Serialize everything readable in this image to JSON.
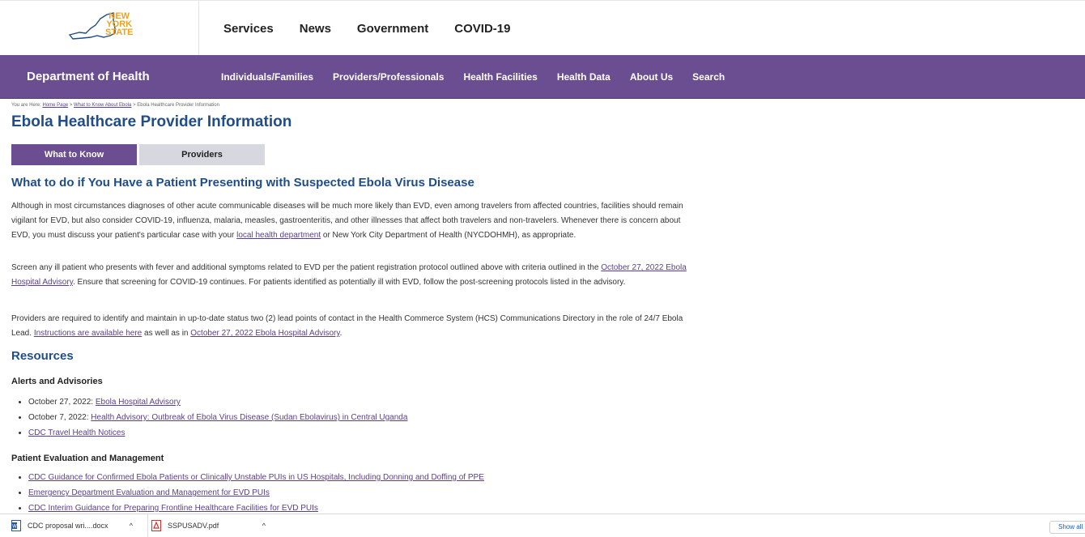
{
  "header": {
    "logo_text_1": "NEW",
    "logo_text_2": "YORK",
    "logo_text_3": "STATE",
    "nav": [
      "Services",
      "News",
      "Government",
      "COVID-19"
    ]
  },
  "subheader": {
    "department": "Department of Health",
    "nav": [
      "Individuals/Families",
      "Providers/Professionals",
      "Health Facilities",
      "Health Data",
      "About Us",
      "Search"
    ]
  },
  "breadcrumb": {
    "prefix": "You are Here:",
    "home": "Home Page",
    "sep1": " > ",
    "ebola": "What to Know About Ebola",
    "sep2": " > ",
    "current": "Ebola Healthcare Provider Information"
  },
  "page": {
    "title": "Ebola Healthcare Provider Information",
    "tabs": [
      "What to Know",
      "Providers"
    ],
    "section_title": "What to do if You Have a Patient Presenting with Suspected Ebola Virus Disease",
    "p1_a": "Although in most circumstances diagnoses of other acute communicable diseases will be much more likely than EVD, even among travelers from affected countries, facilities should remain vigilant for EVD, but also consider COVID-19, influenza, malaria, measles, gastroenteritis, and other illnesses that affect both travelers and non-travelers. Whenever there is concern about EVD, you must discuss your patient's particular case with your ",
    "p1_link": "local health department",
    "p1_b": " or New York City Department of Health (NYCDOHMH), as appropriate.",
    "p2_a": "Screen any ill patient who presents with fever and additional symptoms related to EVD per the patient registration protocol outlined above with criteria outlined in the ",
    "p2_link": "October 27, 2022 Ebola Hospital Advisory",
    "p2_b": ". Ensure that screening for COVID-19 continues. For patients identified as potentially ill with EVD, follow the post-screening protocols listed in the advisory.",
    "p3_a": "Providers are required to identify and maintain in up-to-date status two (2) lead points of contact in the Health Commerce System (HCS) Communications Directory in the role of 24/7 Ebola Lead. ",
    "p3_link1": "Instructions are available here",
    "p3_mid": " as well as in ",
    "p3_link2": "October 27, 2022 Ebola Hospital Advisory",
    "p3_end": ".",
    "resources_title": "Resources",
    "alerts_title": "Alerts and Advisories",
    "alerts": [
      {
        "prefix": "October 27, 2022: ",
        "link": "Ebola Hospital Advisory"
      },
      {
        "prefix": "October 7, 2022: ",
        "link": "Health Advisory: Outbreak of Ebola Virus Disease (Sudan Ebolavirus) in Central Uganda"
      },
      {
        "prefix": "",
        "link": "CDC Travel Health Notices"
      }
    ],
    "patient_title": "Patient Evaluation and Management",
    "patient_links": [
      "CDC Guidance for Confirmed Ebola Patients or Clinically Unstable PUIs in US Hospitals, Including Donning and Doffing of PPE",
      "Emergency Department Evaluation and Management for EVD PUIs",
      "CDC Interim Guidance for Preparing Frontline Healthcare Facilities for EVD PUIs"
    ]
  },
  "downloads": {
    "file1": "CDC proposal wri....docx",
    "file2": "SSPUSADV.pdf",
    "show_all": "Show all"
  },
  "colors": {
    "purple": "#6b4e91",
    "title_blue": "#1f4d89",
    "logo_orange": "#f0a21b"
  }
}
